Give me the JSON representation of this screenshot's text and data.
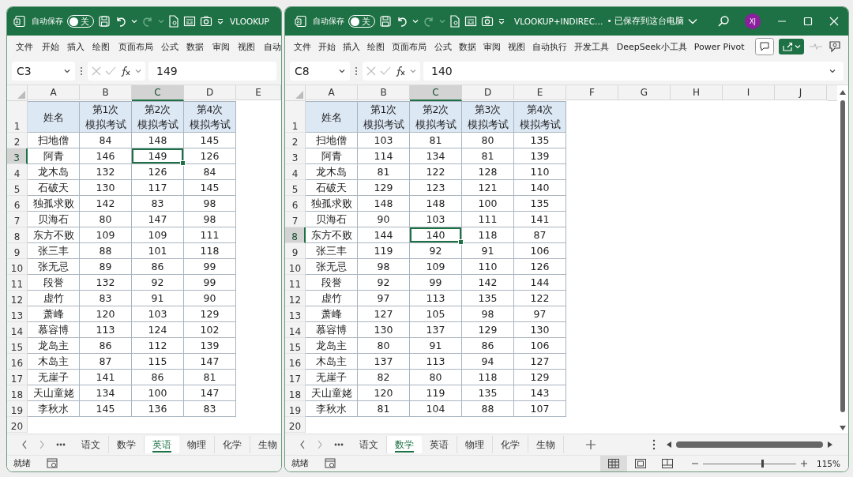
{
  "windows": [
    {
      "window_controls": false,
      "autosave_label": "自动保存",
      "toggle": {
        "label": "关",
        "on": false
      },
      "title": "VLOOKUP",
      "menu": [
        "文件",
        "开始",
        "插入",
        "绘图",
        "页面布局",
        "公式",
        "数据",
        "审阅",
        "视图",
        "自动"
      ],
      "name_box": "C3",
      "formula": "149",
      "columns": [
        {
          "label": "A",
          "selected": false
        },
        {
          "label": "B",
          "selected": false
        },
        {
          "label": "C",
          "selected": true
        },
        {
          "label": "D",
          "selected": false
        },
        {
          "label": "E",
          "selected": false
        }
      ],
      "rows": [
        {
          "number": "1",
          "selected": false,
          "kind": "header",
          "cells": [
            "姓名",
            "第1次模拟考试",
            "第2次模拟考试",
            "第4次模拟考试"
          ]
        },
        {
          "number": "2",
          "selected": false,
          "kind": "data",
          "cells": [
            "扫地僧",
            "84",
            "148",
            "145"
          ]
        },
        {
          "number": "3",
          "selected": true,
          "kind": "data",
          "cells": [
            "阿青",
            "146",
            "149",
            "126"
          ]
        },
        {
          "number": "4",
          "selected": false,
          "kind": "data",
          "cells": [
            "龙木岛",
            "132",
            "126",
            "84"
          ]
        },
        {
          "number": "5",
          "selected": false,
          "kind": "data",
          "cells": [
            "石破天",
            "130",
            "117",
            "145"
          ]
        },
        {
          "number": "6",
          "selected": false,
          "kind": "data",
          "cells": [
            "独孤求败",
            "142",
            "83",
            "98"
          ]
        },
        {
          "number": "7",
          "selected": false,
          "kind": "data",
          "cells": [
            "贝海石",
            "80",
            "147",
            "98"
          ]
        },
        {
          "number": "8",
          "selected": false,
          "kind": "data",
          "cells": [
            "东方不败",
            "109",
            "109",
            "111"
          ]
        },
        {
          "number": "9",
          "selected": false,
          "kind": "data",
          "cells": [
            "张三丰",
            "88",
            "101",
            "118"
          ]
        },
        {
          "number": "10",
          "selected": false,
          "kind": "data",
          "cells": [
            "张无忌",
            "89",
            "86",
            "99"
          ]
        },
        {
          "number": "11",
          "selected": false,
          "kind": "data",
          "cells": [
            "段誉",
            "132",
            "92",
            "99"
          ]
        },
        {
          "number": "12",
          "selected": false,
          "kind": "data",
          "cells": [
            "虚竹",
            "83",
            "91",
            "90"
          ]
        },
        {
          "number": "13",
          "selected": false,
          "kind": "data",
          "cells": [
            "萧峰",
            "120",
            "103",
            "129"
          ]
        },
        {
          "number": "14",
          "selected": false,
          "kind": "data",
          "cells": [
            "慕容博",
            "113",
            "124",
            "102"
          ]
        },
        {
          "number": "15",
          "selected": false,
          "kind": "data",
          "cells": [
            "龙岛主",
            "86",
            "112",
            "139"
          ]
        },
        {
          "number": "16",
          "selected": false,
          "kind": "data",
          "cells": [
            "木岛主",
            "87",
            "115",
            "147"
          ]
        },
        {
          "number": "17",
          "selected": false,
          "kind": "data",
          "cells": [
            "无崖子",
            "141",
            "86",
            "81"
          ]
        },
        {
          "number": "18",
          "selected": false,
          "kind": "data",
          "cells": [
            "天山童姥",
            "134",
            "100",
            "147"
          ]
        },
        {
          "number": "19",
          "selected": false,
          "kind": "data",
          "cells": [
            "李秋水",
            "145",
            "136",
            "83"
          ]
        },
        {
          "number": "20",
          "selected": false,
          "kind": "data"
        }
      ],
      "sheet_tabs": [
        {
          "label": "语文",
          "selected": false
        },
        {
          "label": "数学",
          "selected": false
        },
        {
          "label": "英语",
          "selected": true
        },
        {
          "label": "物理",
          "selected": false
        },
        {
          "label": "化学",
          "selected": false
        },
        {
          "label": "生物",
          "selected": false
        }
      ],
      "status": "就绪"
    },
    {
      "window_controls": true,
      "autosave_label": "自动保存",
      "toggle": {
        "label": "关",
        "on": false
      },
      "title": "VLOOKUP+INDIREC…",
      "save_status": "• 已保存到这台电脑",
      "avatar": "XJ",
      "menu": [
        "文件",
        "开始",
        "插入",
        "绘图",
        "页面布局",
        "公式",
        "数据",
        "审阅",
        "视图",
        "自动执行",
        "开发工具",
        "DeepSeek小工具",
        "Power Pivot"
      ],
      "name_box": "C8",
      "formula": "140",
      "columns": [
        {
          "label": "A",
          "selected": false
        },
        {
          "label": "B",
          "selected": false
        },
        {
          "label": "C",
          "selected": true
        },
        {
          "label": "D",
          "selected": false
        },
        {
          "label": "E",
          "selected": false
        },
        {
          "label": "F",
          "selected": false
        },
        {
          "label": "G",
          "selected": false
        },
        {
          "label": "H",
          "selected": false
        },
        {
          "label": "I",
          "selected": false
        },
        {
          "label": "J",
          "selected": false
        }
      ],
      "rows": [
        {
          "number": "1",
          "selected": false,
          "kind": "header",
          "cells": [
            "姓名",
            "第1次模拟考试",
            "第2次模拟考试",
            "第3次模拟考试",
            "第4次模拟考试"
          ]
        },
        {
          "number": "2",
          "selected": false,
          "kind": "data",
          "cells": [
            "扫地僧",
            "103",
            "81",
            "80",
            "135"
          ]
        },
        {
          "number": "3",
          "selected": false,
          "kind": "data",
          "cells": [
            "阿青",
            "114",
            "134",
            "81",
            "139"
          ]
        },
        {
          "number": "4",
          "selected": false,
          "kind": "data",
          "cells": [
            "龙木岛",
            "81",
            "122",
            "128",
            "110"
          ]
        },
        {
          "number": "5",
          "selected": false,
          "kind": "data",
          "cells": [
            "石破天",
            "129",
            "123",
            "121",
            "140"
          ]
        },
        {
          "number": "6",
          "selected": false,
          "kind": "data",
          "cells": [
            "独孤求败",
            "148",
            "148",
            "100",
            "135"
          ]
        },
        {
          "number": "7",
          "selected": false,
          "kind": "data",
          "cells": [
            "贝海石",
            "90",
            "103",
            "111",
            "141"
          ]
        },
        {
          "number": "8",
          "selected": true,
          "kind": "data",
          "cells": [
            "东方不败",
            "144",
            "140",
            "118",
            "87"
          ]
        },
        {
          "number": "9",
          "selected": false,
          "kind": "data",
          "cells": [
            "张三丰",
            "119",
            "92",
            "91",
            "106"
          ]
        },
        {
          "number": "10",
          "selected": false,
          "kind": "data",
          "cells": [
            "张无忌",
            "98",
            "109",
            "110",
            "126"
          ]
        },
        {
          "number": "11",
          "selected": false,
          "kind": "data",
          "cells": [
            "段誉",
            "92",
            "99",
            "142",
            "144"
          ]
        },
        {
          "number": "12",
          "selected": false,
          "kind": "data",
          "cells": [
            "虚竹",
            "97",
            "113",
            "135",
            "122"
          ]
        },
        {
          "number": "13",
          "selected": false,
          "kind": "data",
          "cells": [
            "萧峰",
            "127",
            "105",
            "98",
            "97"
          ]
        },
        {
          "number": "14",
          "selected": false,
          "kind": "data",
          "cells": [
            "慕容博",
            "130",
            "137",
            "129",
            "130"
          ]
        },
        {
          "number": "15",
          "selected": false,
          "kind": "data",
          "cells": [
            "龙岛主",
            "80",
            "91",
            "86",
            "106"
          ]
        },
        {
          "number": "16",
          "selected": false,
          "kind": "data",
          "cells": [
            "木岛主",
            "137",
            "113",
            "94",
            "127"
          ]
        },
        {
          "number": "17",
          "selected": false,
          "kind": "data",
          "cells": [
            "无崖子",
            "82",
            "80",
            "118",
            "129"
          ]
        },
        {
          "number": "18",
          "selected": false,
          "kind": "data",
          "cells": [
            "天山童姥",
            "120",
            "119",
            "135",
            "143"
          ]
        },
        {
          "number": "19",
          "selected": false,
          "kind": "data",
          "cells": [
            "李秋水",
            "81",
            "104",
            "88",
            "107"
          ]
        },
        {
          "number": "20",
          "selected": false,
          "kind": "data"
        }
      ],
      "sheet_tabs": [
        {
          "label": "语文",
          "selected": false
        },
        {
          "label": "数学",
          "selected": true
        },
        {
          "label": "英语",
          "selected": false
        },
        {
          "label": "物理",
          "selected": false
        },
        {
          "label": "化学",
          "selected": false
        },
        {
          "label": "生物",
          "selected": false
        }
      ],
      "status": "就绪",
      "zoom": "115%",
      "zoom_slider": {
        "level": 0.64
      }
    }
  ]
}
